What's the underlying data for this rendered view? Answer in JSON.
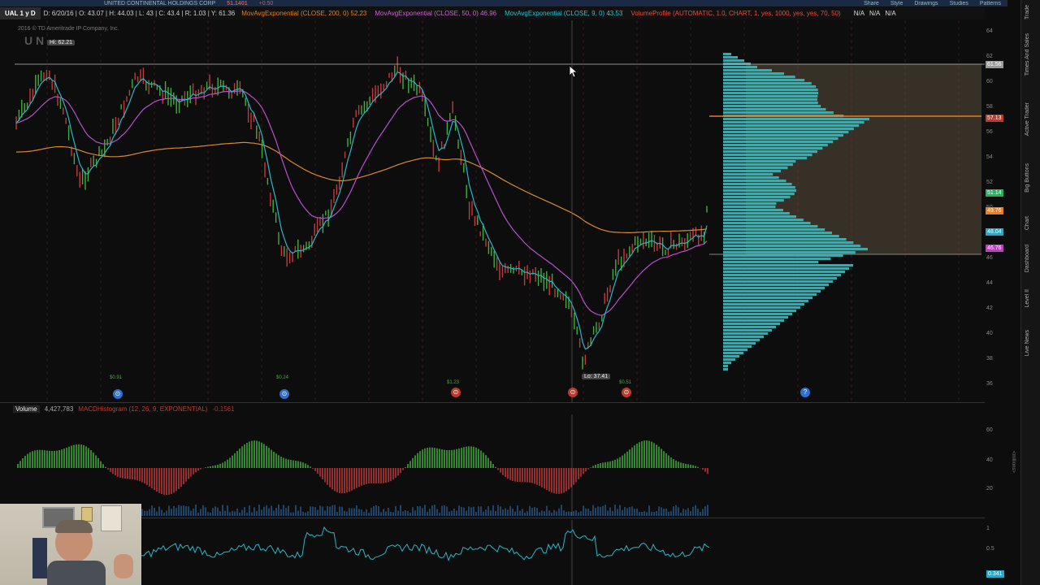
{
  "topbar": {
    "company": "UNITED CONTINENTAL HOLDINGS CORP",
    "last_price": "51.1401",
    "change": "+0.50",
    "share_label": "Share",
    "style_label": "Style",
    "drawings_label": "Drawings",
    "studies_label": "Studies",
    "patterns_label": "Patterns"
  },
  "studybar": {
    "symbol": "UAL 1 y D",
    "ohlc": "D: 6/20/16 | O: 43.07 | H: 44.03 | L: 43 | C: 43.4 | R: 1.03 | Y: 61.36",
    "ma1": "MovAvgExponential (CLOSE, 200, 0) 52.23",
    "ma2": "MovAvgExponential (CLOSE, 50, 0) 46.96",
    "ma3": "MovAvgExponential (CLOSE, 9, 0) 43.53",
    "vp": "VolumeProfile (AUTOMATIC, 1.0, CHART, 1, yes, 1000, yes, yes, 70, 50)",
    "na1": "N/A",
    "na2": "N/A",
    "na3": "N/A"
  },
  "chart": {
    "copyright": "2016 © TD Ameritrade IP Company, Inc.",
    "hi_label": "Hi: 62.21",
    "lo_label": "Lo: 37.41",
    "watermark": "U N",
    "price_axis": [
      "64",
      "62",
      "60",
      "58",
      "56",
      "54",
      "52",
      "50",
      "48",
      "46",
      "44",
      "42",
      "40",
      "38",
      "36"
    ],
    "price_tags": [
      {
        "text": "61.56",
        "color": "#9a9a9a"
      },
      {
        "text": "57.13",
        "color": "#c0392b"
      },
      {
        "text": "51.14",
        "color": "#27ae60"
      },
      {
        "text": "49.76",
        "color": "#e67e22"
      },
      {
        "text": "48.04",
        "color": "#2aa7c4"
      },
      {
        "text": "46.76",
        "color": "#c03fc4"
      }
    ],
    "event_marks": [
      "$0.91",
      "$0.24",
      "$1.23",
      "$0.51"
    ]
  },
  "volume_panel": {
    "label": "Volume",
    "value": "4,427,783",
    "macd_label": "MACDHistogram (12, 26, 9, EXPONENTIAL)",
    "macd_value": "-0.1561",
    "axis": [
      "60",
      "40",
      "20"
    ],
    "unit": "<millions>"
  },
  "lower_panel": {
    "axis": [
      "1",
      "0.5"
    ],
    "value_tag": "0.341"
  },
  "sidebar": {
    "tabs": [
      "Trade",
      "Times And Sales",
      "Active Trader",
      "Big Buttons",
      "Chart",
      "Dashboard",
      "Level II",
      "Live News"
    ]
  },
  "colors": {
    "ma_200": "#d88a2c",
    "ma_50": "#b84fd0",
    "ma_9": "#2bb6c8",
    "up_bar": "#3fae3a",
    "down_bar": "#c23a3a",
    "profile": "#1fc5cc"
  }
}
